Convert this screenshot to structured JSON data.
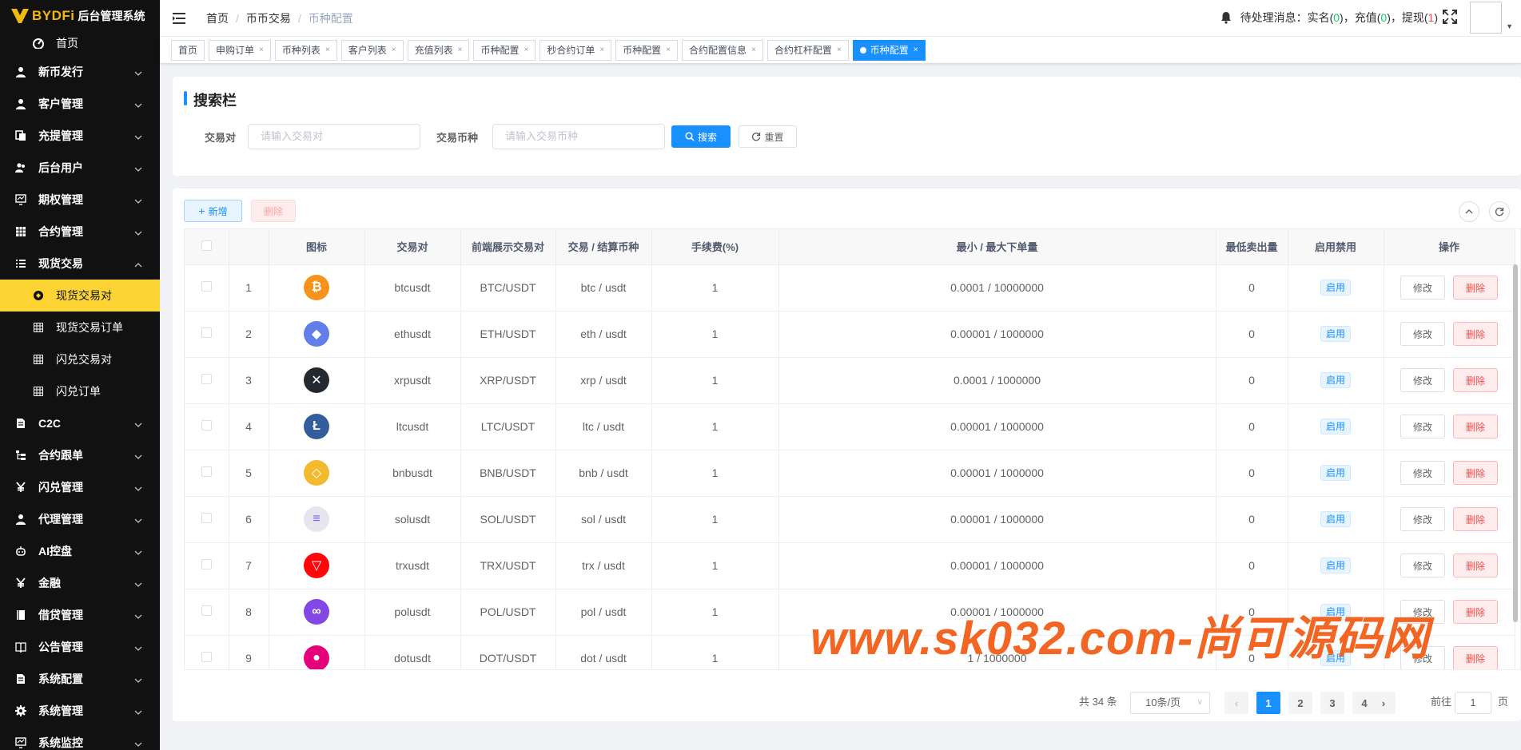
{
  "app": {
    "brand": "BYDFi",
    "system_name": "后台管理系统"
  },
  "sidebar": {
    "home": "首页",
    "items": [
      {
        "label": "新币发行",
        "icon": "user-icon"
      },
      {
        "label": "客户管理",
        "icon": "user-icon"
      },
      {
        "label": "充提管理",
        "icon": "copy-icon"
      },
      {
        "label": "后台用户",
        "icon": "peoples-icon"
      },
      {
        "label": "期权管理",
        "icon": "monitor-icon"
      },
      {
        "label": "合约管理",
        "icon": "table-icon"
      },
      {
        "label": "现货交易",
        "icon": "list-icon"
      }
    ],
    "spot_sub": [
      {
        "label": "现货交易对",
        "active": true
      },
      {
        "label": "现货交易订单",
        "active": false
      },
      {
        "label": "闪兑交易对",
        "active": false
      },
      {
        "label": "闪兑订单",
        "active": false
      }
    ],
    "items2": [
      {
        "label": "C2C",
        "icon": "doc-icon"
      },
      {
        "label": "合约跟单",
        "icon": "tree-icon"
      },
      {
        "label": "闪兑管理",
        "icon": "yen-icon"
      },
      {
        "label": "代理管理",
        "icon": "user-icon"
      },
      {
        "label": "AI控盘",
        "icon": "robot-icon"
      },
      {
        "label": "金融",
        "icon": "yen-icon"
      },
      {
        "label": "借贷管理",
        "icon": "book-icon"
      },
      {
        "label": "公告管理",
        "icon": "open-book-icon"
      },
      {
        "label": "系统配置",
        "icon": "doc-icon"
      },
      {
        "label": "系统管理",
        "icon": "gear-icon"
      },
      {
        "label": "系统监控",
        "icon": "monitor-icon"
      }
    ]
  },
  "header": {
    "breadcrumb": [
      "首页",
      "币币交易",
      "币种配置"
    ],
    "notice_prefix": "待处理消息：",
    "notice_kyc": "实名",
    "notice_kyc_count": "0",
    "notice_deposit": "充值",
    "notice_deposit_count": "0",
    "notice_withdraw": "提现",
    "notice_withdraw_count": "1"
  },
  "tags": [
    {
      "label": "首页",
      "closable": false,
      "active": false
    },
    {
      "label": "申购订单",
      "closable": true,
      "active": false
    },
    {
      "label": "币种列表",
      "closable": true,
      "active": false
    },
    {
      "label": "客户列表",
      "closable": true,
      "active": false
    },
    {
      "label": "充值列表",
      "closable": true,
      "active": false
    },
    {
      "label": "币种配置",
      "closable": true,
      "active": false
    },
    {
      "label": "秒合约订单",
      "closable": true,
      "active": false
    },
    {
      "label": "币种配置",
      "closable": true,
      "active": false
    },
    {
      "label": "合约配置信息",
      "closable": true,
      "active": false
    },
    {
      "label": "合约杠杆配置",
      "closable": true,
      "active": false
    },
    {
      "label": "币种配置",
      "closable": true,
      "active": true
    }
  ],
  "search": {
    "title": "搜索栏",
    "pair_label": "交易对",
    "pair_placeholder": "请输入交易对",
    "coin_label": "交易币种",
    "coin_placeholder": "请输入交易币种",
    "search_btn": "搜索",
    "reset_btn": "重置"
  },
  "toolbar": {
    "add_btn": "新增",
    "delete_btn": "删除"
  },
  "table": {
    "columns": [
      "图标",
      "交易对",
      "前端展示交易对",
      "交易 / 结算币种",
      "手续费(%)",
      "最小 / 最大下单量",
      "最低卖出量",
      "启用禁用",
      "操作"
    ],
    "edit_label": "修改",
    "delete_label": "删除",
    "rows": [
      {
        "idx": "1",
        "coin": "btc",
        "color": "#f7931a",
        "glyph": "₿",
        "pair": "btcusdt",
        "display": "BTC/USDT",
        "coins": "btc / usdt",
        "fee": "1",
        "minmax": "0.0001 / 10000000",
        "min_sell": "0",
        "status": "启用"
      },
      {
        "idx": "2",
        "coin": "eth",
        "color": "#627eea",
        "glyph": "◆",
        "pair": "ethusdt",
        "display": "ETH/USDT",
        "coins": "eth / usdt",
        "fee": "1",
        "minmax": "0.00001 / 1000000",
        "min_sell": "0",
        "status": "启用"
      },
      {
        "idx": "3",
        "coin": "xrp",
        "color": "#23292f",
        "glyph": "✕",
        "pair": "xrpusdt",
        "display": "XRP/USDT",
        "coins": "xrp / usdt",
        "fee": "1",
        "minmax": "0.0001 / 1000000",
        "min_sell": "0",
        "status": "启用"
      },
      {
        "idx": "4",
        "coin": "ltc",
        "color": "#345d9d",
        "glyph": "Ł",
        "pair": "ltcusdt",
        "display": "LTC/USDT",
        "coins": "ltc / usdt",
        "fee": "1",
        "minmax": "0.00001 / 1000000",
        "min_sell": "0",
        "status": "启用"
      },
      {
        "idx": "5",
        "coin": "bnb",
        "color": "#f3ba2f",
        "glyph": "◇",
        "pair": "bnbusdt",
        "display": "BNB/USDT",
        "coins": "bnb / usdt",
        "fee": "1",
        "minmax": "0.00001 / 1000000",
        "min_sell": "0",
        "status": "启用"
      },
      {
        "idx": "6",
        "coin": "sol",
        "color": "#e6e6ee",
        "glyph": "≡",
        "pair": "solusdt",
        "display": "SOL/USDT",
        "coins": "sol / usdt",
        "fee": "1",
        "minmax": "0.00001 / 1000000",
        "min_sell": "0",
        "status": "启用"
      },
      {
        "idx": "7",
        "coin": "trx",
        "color": "#ff060a",
        "glyph": "▽",
        "pair": "trxusdt",
        "display": "TRX/USDT",
        "coins": "trx / usdt",
        "fee": "1",
        "minmax": "0.00001 / 1000000",
        "min_sell": "0",
        "status": "启用"
      },
      {
        "idx": "8",
        "coin": "pol",
        "color": "#8247e5",
        "glyph": "∞",
        "pair": "polusdt",
        "display": "POL/USDT",
        "coins": "pol / usdt",
        "fee": "1",
        "minmax": "0.00001 / 1000000",
        "min_sell": "0",
        "status": "启用"
      },
      {
        "idx": "9",
        "coin": "dot",
        "color": "#e6007a",
        "glyph": "●",
        "pair": "dotusdt",
        "display": "DOT/USDT",
        "coins": "dot / usdt",
        "fee": "1",
        "minmax": "1 / 1000000",
        "min_sell": "0",
        "status": "启用"
      }
    ]
  },
  "pagination": {
    "total": "共 34 条",
    "page_size": "10条/页",
    "pages": [
      "1",
      "2",
      "3",
      "4"
    ],
    "current": "1",
    "goto_prefix": "前往",
    "goto_value": "1",
    "goto_suffix": "页"
  },
  "watermark": "www.sk032.com-尚可源码网"
}
